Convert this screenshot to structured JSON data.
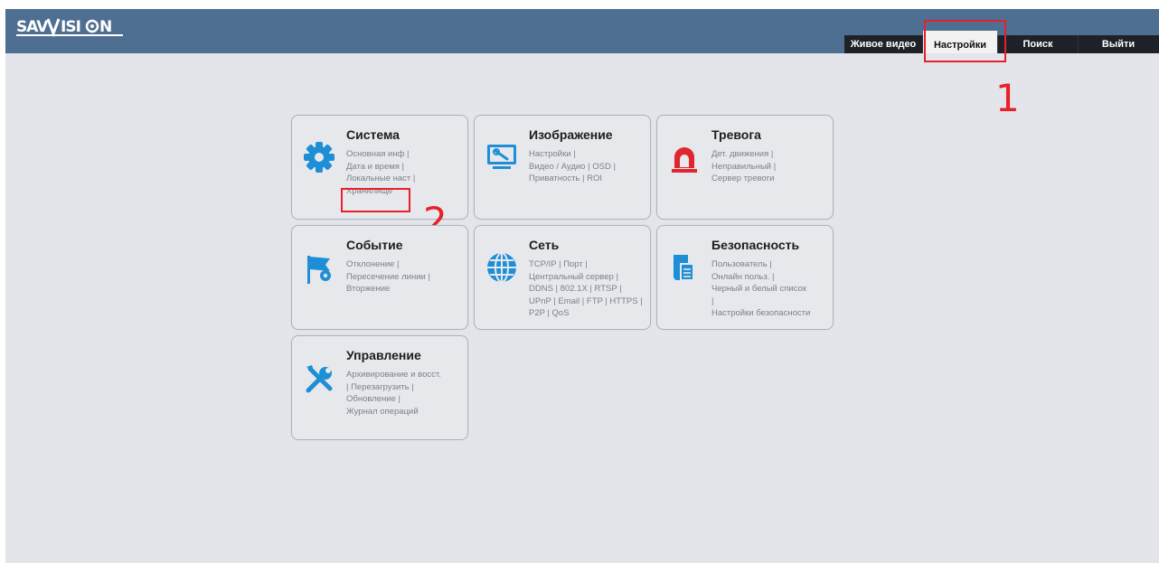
{
  "header": {
    "logo_text": "SAVVISION"
  },
  "nav": {
    "items": [
      {
        "label": "Живое видео"
      },
      {
        "label": "Настройки",
        "active": true
      },
      {
        "label": "Поиск"
      },
      {
        "label": "Выйти"
      }
    ]
  },
  "annotations": {
    "step1": "1",
    "step2": "2",
    "color": "#e8202a"
  },
  "cards": [
    {
      "title": "Система",
      "icon": "gear-icon",
      "links": [
        "Основная инф |",
        "Дата и время |",
        "Локальные наст |",
        "Хранилище"
      ]
    },
    {
      "title": "Изображение",
      "icon": "monitor-settings-icon",
      "links": [
        "Настройки |",
        "Видео / Аудио | OSD |",
        "Приватность | ROI"
      ]
    },
    {
      "title": "Тревога",
      "icon": "alarm-siren-icon",
      "links": [
        "Дет. движения |",
        "Неправильный |",
        "Сервер тревоги"
      ]
    },
    {
      "title": "Событие",
      "icon": "event-flag-icon",
      "links": [
        "Отклонение |",
        "Пересечение линии |",
        "Вторжение"
      ]
    },
    {
      "title": "Сеть",
      "icon": "globe-icon",
      "links": [
        "TCP/IP | Порт |",
        "Центральный сервер |",
        "DDNS | 802.1X | RTSP |",
        "UPnP | Email | FTP | HTTPS |",
        "P2P | QoS"
      ]
    },
    {
      "title": "Безопасность",
      "icon": "security-shield-icon",
      "links": [
        "Пользователь |",
        "Онлайн польз. |",
        "Черный и белый список",
        "|",
        "Настройки безопасности"
      ]
    },
    {
      "title": "Управление",
      "icon": "tools-icon",
      "links": [
        "Архивирование и восст.",
        "| Перезагрузить |",
        "Обновление |",
        "Журнал операций"
      ]
    }
  ],
  "colors": {
    "header_bg": "#4e6f92",
    "nav_bg": "#1e2228",
    "page_bg": "#e3e5ea",
    "icon_blue": "#1e8fd6",
    "icon_red": "#e0262f"
  }
}
